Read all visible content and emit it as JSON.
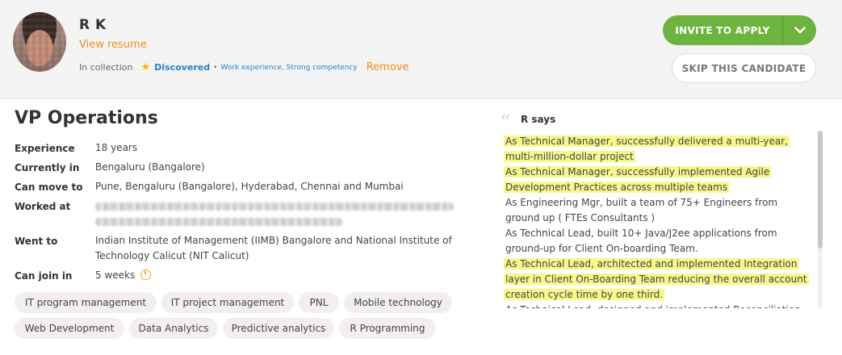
{
  "candidate": {
    "name": "R K",
    "view_resume": "View resume",
    "collection_prefix": "In collection",
    "collection_status": "Discovered",
    "collection_tags": "Work experience, Strong competency",
    "remove_label": "Remove"
  },
  "actions": {
    "invite_label": "INVITE TO APPLY",
    "skip_label": "SKIP THIS CANDIDATE"
  },
  "job": {
    "title": "VP Operations",
    "fields": {
      "experience": {
        "label": "Experience",
        "value": "18 years"
      },
      "currently_in": {
        "label": "Currently in",
        "value": "Bengaluru (Bangalore)"
      },
      "can_move_to": {
        "label": "Can move to",
        "value": "Pune, Bengaluru (Bangalore), Hyderabad, Chennai and Mumbai"
      },
      "worked_at": {
        "label": "Worked at",
        "value": ""
      },
      "went_to": {
        "label": "Went to",
        "value_line1": "Indian Institute of Management (IIMB) Bangalore and National Institute of",
        "value_line2": "Technology Calicut (NIT Calicut)"
      },
      "can_join_in": {
        "label": "Can join in",
        "value": "5 weeks"
      }
    }
  },
  "skills": [
    "IT program management",
    "IT project management",
    "PNL",
    "Mobile technology",
    "Web Development",
    "Data Analytics",
    "Predictive analytics",
    "R Programming"
  ],
  "says": {
    "title": "R says",
    "lines": [
      {
        "text": "As Technical Manager, successfully delivered a multi-year,",
        "highlight": true
      },
      {
        "text": "multi-million-dollar project",
        "highlight": true
      },
      {
        "text": " As Technical Manager, successfully implemented Agile",
        "highlight": true
      },
      {
        "text": "Development Practices across multiple teams",
        "highlight": true
      },
      {
        "text": " As Engineering Mgr, built a team of 75+ Engineers from",
        "highlight": false
      },
      {
        "text": "ground up ( FTEs Consultants )",
        "highlight": false
      },
      {
        "text": " As Technical Lead, built 10+ Java/J2ee applications from",
        "highlight": false
      },
      {
        "text": "ground-up for Client On-boarding Team.",
        "highlight": false
      },
      {
        "text": " As Technical Lead, architected and implemented Integration",
        "highlight": true
      },
      {
        "text": "layer in Client On-Boarding Team reducing the overall account",
        "highlight": true
      },
      {
        "text": "creation cycle time by one third.",
        "highlight": true
      },
      {
        "text": " As Technical Lead, designed and implemented Reconciliation",
        "highlight": false
      }
    ]
  },
  "colors": {
    "accent_green": "#6cb33f",
    "link_orange": "#f08b1f",
    "highlight": "#f7f78a",
    "blue": "#2a7fc4"
  },
  "icons": {
    "star": "star-icon",
    "caret": "chevron-down-icon",
    "clock": "clock-icon",
    "quote": "quote-icon"
  }
}
